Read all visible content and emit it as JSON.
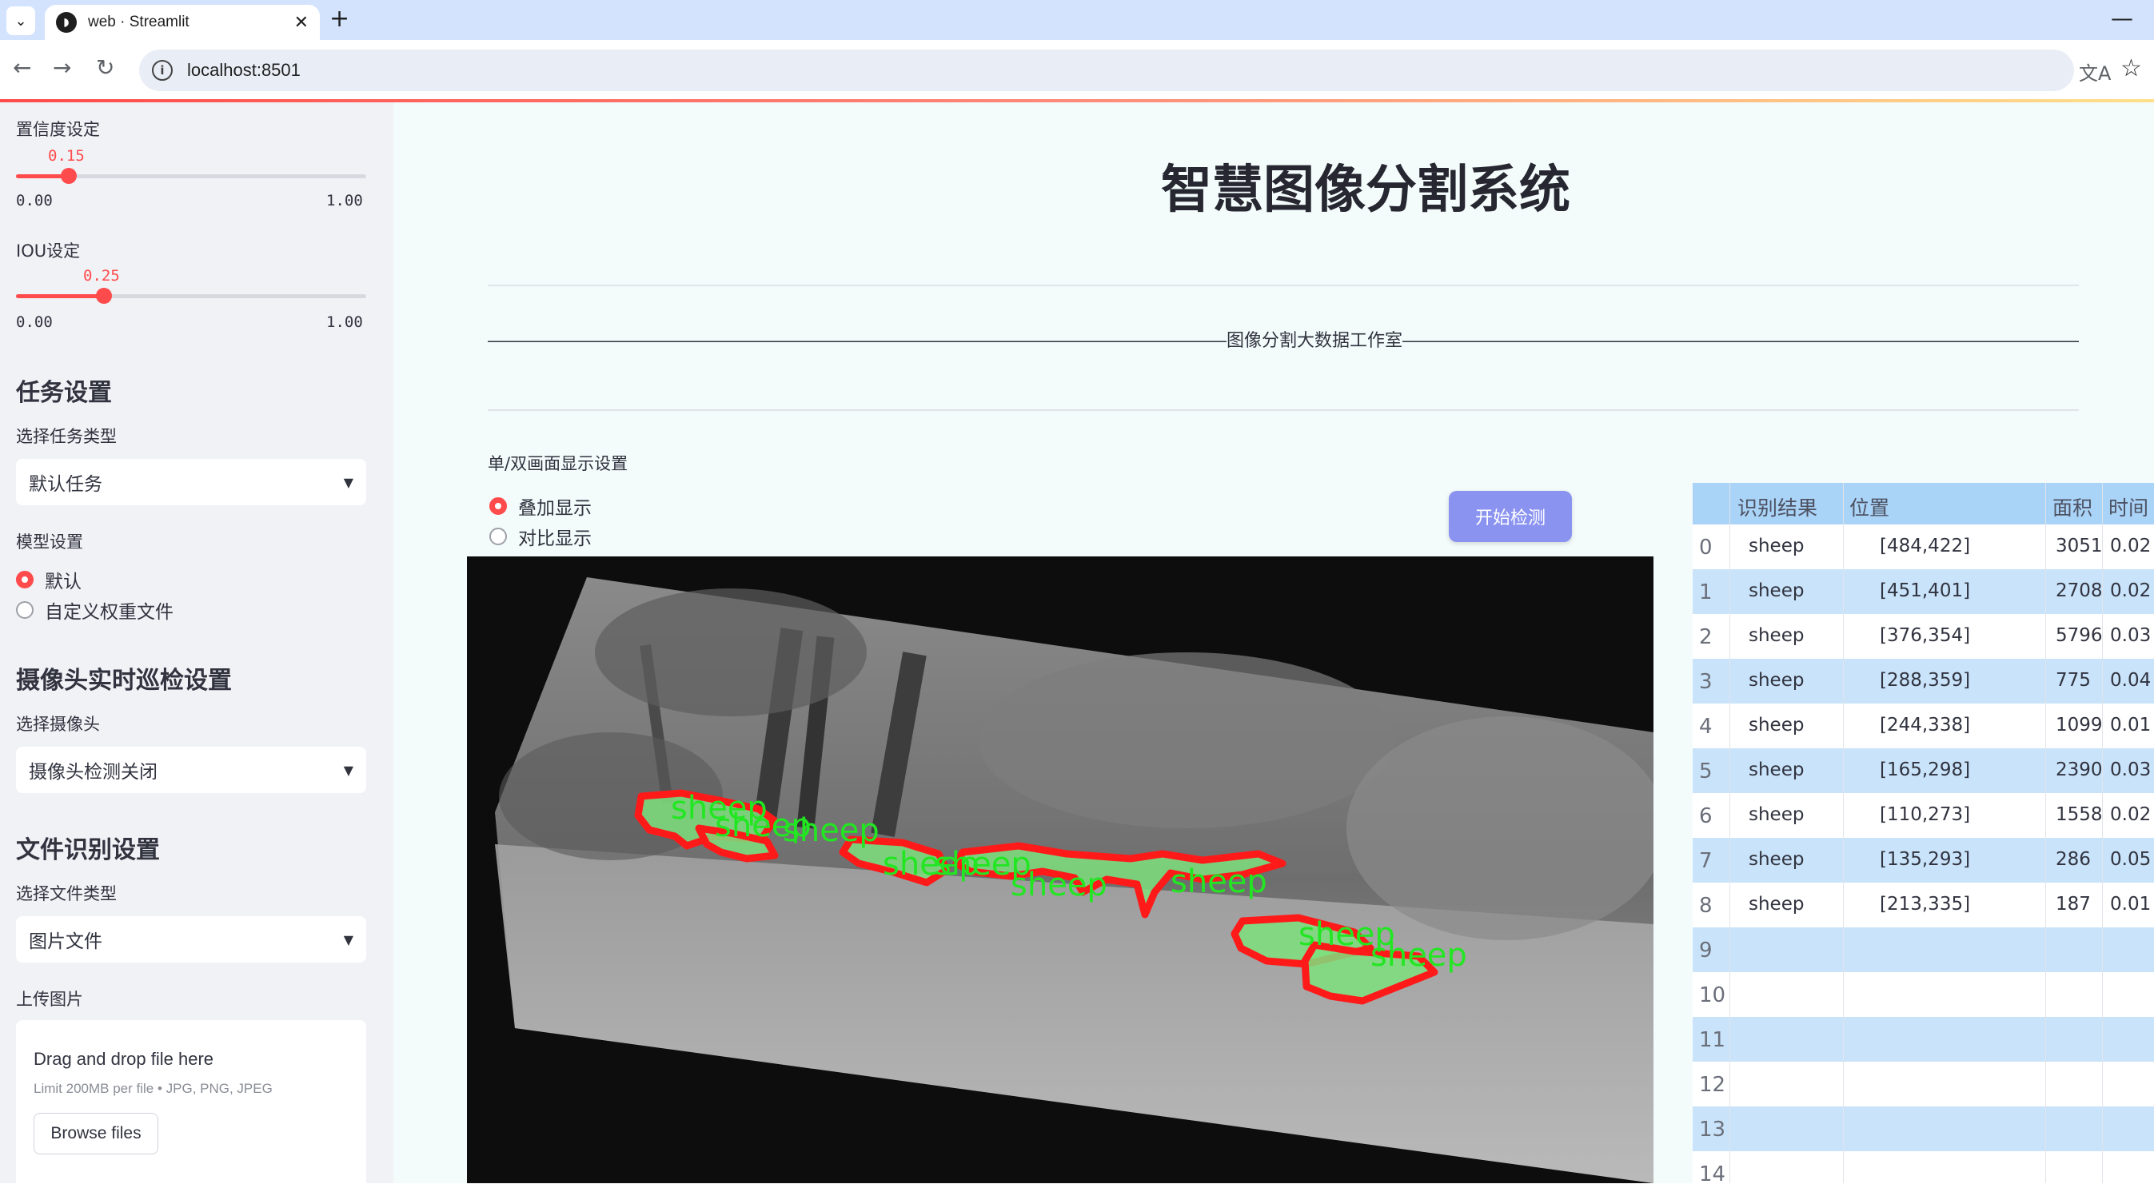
{
  "browser": {
    "tab_title": "web · Streamlit",
    "url": "localhost:8501"
  },
  "sidebar": {
    "confidence": {
      "label": "置信度设定",
      "value": "0.15",
      "fraction": 0.15,
      "min": "0.00",
      "max": "1.00"
    },
    "iou": {
      "label": "IOU设定",
      "value": "0.25",
      "fraction": 0.25,
      "min": "0.00",
      "max": "1.00"
    },
    "task_heading": "任务设置",
    "task_type_label": "选择任务类型",
    "task_type_value": "默认任务",
    "model_label": "模型设置",
    "model_options": [
      "默认",
      "自定义权重文件"
    ],
    "model_selected": "默认",
    "camera_heading": "摄像头实时巡检设置",
    "camera_label": "选择摄像头",
    "camera_value": "摄像头检测关闭",
    "file_heading": "文件识别设置",
    "file_type_label": "选择文件类型",
    "file_type_value": "图片文件",
    "upload_label": "上传图片",
    "upload_title": "Drag and drop file here",
    "upload_limit": "Limit 200MB per file • JPG, PNG, JPEG",
    "browse_label": "Browse files"
  },
  "main": {
    "title": "智慧图像分割系统",
    "studio_line": "——————————————————————————————————————————图像分割大数据工作室——————————————————————————————————————————————",
    "display_label": "单/双画面显示设置",
    "display_options": [
      "叠加显示",
      "对比显示"
    ],
    "display_selected": "叠加显示",
    "start_button": "开始检测",
    "detection_label": "sheep"
  },
  "results": {
    "headers": [
      "识别结果",
      "位置",
      "面积",
      "时间"
    ],
    "rows": [
      {
        "idx": "0",
        "label": "sheep",
        "pos": "[484,422]",
        "area": "3051",
        "time": "0.02"
      },
      {
        "idx": "1",
        "label": "sheep",
        "pos": "[451,401]",
        "area": "2708",
        "time": "0.02"
      },
      {
        "idx": "2",
        "label": "sheep",
        "pos": "[376,354]",
        "area": "5796",
        "time": "0.03"
      },
      {
        "idx": "3",
        "label": "sheep",
        "pos": "[288,359]",
        "area": "775",
        "time": "0.04"
      },
      {
        "idx": "4",
        "label": "sheep",
        "pos": "[244,338]",
        "area": "1099",
        "time": "0.01"
      },
      {
        "idx": "5",
        "label": "sheep",
        "pos": "[165,298]",
        "area": "2390",
        "time": "0.03"
      },
      {
        "idx": "6",
        "label": "sheep",
        "pos": "[110,273]",
        "area": "1558",
        "time": "0.02"
      },
      {
        "idx": "7",
        "label": "sheep",
        "pos": "[135,293]",
        "area": "286",
        "time": "0.05"
      },
      {
        "idx": "8",
        "label": "sheep",
        "pos": "[213,335]",
        "area": "187",
        "time": "0.01"
      },
      {
        "idx": "9",
        "label": "",
        "pos": "",
        "area": "",
        "time": ""
      },
      {
        "idx": "10",
        "label": "",
        "pos": "",
        "area": "",
        "time": ""
      },
      {
        "idx": "11",
        "label": "",
        "pos": "",
        "area": "",
        "time": ""
      },
      {
        "idx": "12",
        "label": "",
        "pos": "",
        "area": "",
        "time": ""
      },
      {
        "idx": "13",
        "label": "",
        "pos": "",
        "area": "",
        "time": ""
      },
      {
        "idx": "14",
        "label": "",
        "pos": "",
        "area": "",
        "time": ""
      }
    ]
  },
  "colors": {
    "accent": "#ff4b4b",
    "sidebar_bg": "#f0f2f6",
    "main_bg": "#f3fbfb",
    "table_header": "#a9d3f7",
    "table_alt_row": "#c9e3fa",
    "button": "#8b93f0",
    "mask_outline": "#ff1a1a",
    "mask_fill": "#7ee07e",
    "label_text": "#22e622"
  },
  "icons": [
    "chevron-down-icon",
    "streamlit-favicon",
    "close-icon",
    "plus-icon",
    "minimize-icon",
    "back-arrow-icon",
    "forward-arrow-icon",
    "reload-icon",
    "info-icon",
    "translate-icon",
    "star-icon",
    "caret-down-icon"
  ]
}
